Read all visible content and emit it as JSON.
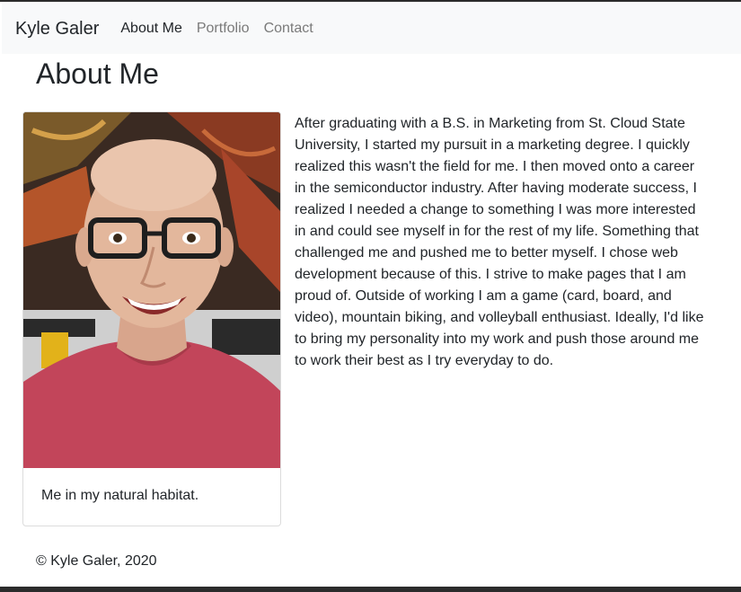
{
  "navbar": {
    "brand": "Kyle Galer",
    "links": [
      {
        "label": "About Me",
        "active": true
      },
      {
        "label": "Portfolio",
        "active": false
      },
      {
        "label": "Contact",
        "active": false
      }
    ]
  },
  "main": {
    "title": "About Me",
    "photo_caption": "Me in my natural habitat.",
    "bio": "After graduating with a B.S. in Marketing from St. Cloud State University, I started my pursuit in a marketing degree. I quickly realized this wasn't the field for me. I then moved onto a career in the semiconductor industry. After having moderate success, I realized I needed a change to something I was more interested in and could see myself in for the rest of my life. Something that challenged me and pushed me to better myself. I chose web development because of this. I strive to make pages that I am proud of. Outside of working I am a game (card, board, and video), mountain biking, and volleyball enthusiast. Ideally, I'd like to bring my personality into my work and push those around me to work their best as I try everyday to do."
  },
  "footer": {
    "text": "© Kyle Galer, 2020"
  },
  "colors": {
    "navbar_bg": "#f8f9fa",
    "text": "#212529",
    "muted_link": "#7a7a7a",
    "shirt": "#c2455a"
  }
}
